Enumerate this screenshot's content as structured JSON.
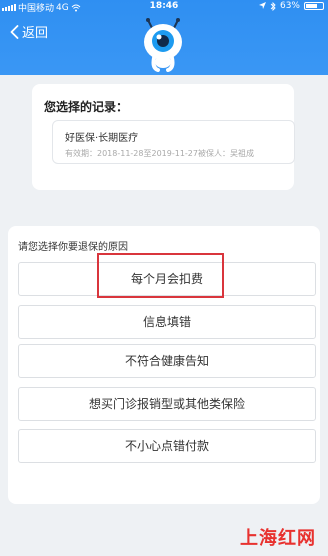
{
  "status_bar": {
    "carrier": "中国移动",
    "network": "4G",
    "time": "18:46",
    "battery": "63%"
  },
  "nav": {
    "back_label": "返回",
    "mascot_icon": "eye-mascot-icon"
  },
  "record_card": {
    "title": "您选择的记录：",
    "product_name": "好医保·长期医疗",
    "validity": "有效期：2018-11-28至2019-11-27被保人：吴祖成"
  },
  "reason_card": {
    "title": "请您选择你要退保的原因",
    "options": [
      "每个月会扣费",
      "信息填错",
      "不符合健康告知",
      "想买门诊报销型或其他类保险",
      "不小心点错付款"
    ]
  },
  "watermark": {
    "text": "上海红网"
  },
  "colors": {
    "header_blue": "#3a97f4",
    "highlight_red": "#d9353c",
    "watermark_red": "#e8322f"
  }
}
